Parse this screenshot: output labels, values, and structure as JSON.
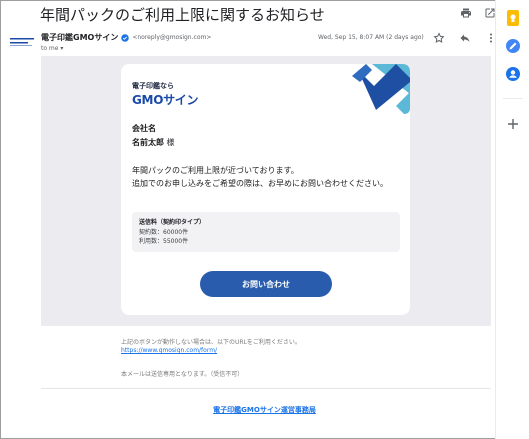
{
  "email": {
    "subject": "年間パックのご利用上限に関するお知らせ",
    "sender_name": "電子印鑑GMOサイン",
    "sender_email": "<noreply@gmosign.com>",
    "recipient_line": "to me ▾",
    "date": "Wed, Sep 15, 8:07 AM (2 days ago)"
  },
  "card": {
    "brand_sub": "電子印鑑なら",
    "brand_main": "GMOサイン",
    "company": "会社名",
    "person_name": "名前太郎",
    "honorific": " 様",
    "body_line1": "年間パックのご利用上限が近づいております。",
    "body_line2": "追加でのお申し込みをご希望の際は、お早めにお問い合わせください。",
    "info_title": "送信料（契約印タイプ）",
    "info_contract": "契約数：60000件",
    "info_usage": "利用数：55000件",
    "cta_label": "お問い合わせ"
  },
  "footer": {
    "note_button": "上記のボタンが動作しない場合は、以下のURLをご利用ください。",
    "url": "https://www.gmosign.com/form/",
    "note_sendonly": "本メールは送信専用となります。（受信不可）",
    "office_link": "電子印鑑GMOサイン運営事務局"
  },
  "icons": {
    "print": "print-icon",
    "open_new": "open-in-new-icon",
    "star": "star-icon",
    "reply": "reply-icon",
    "more": "more-vert-icon",
    "keep": "keep-icon",
    "tasks": "tasks-icon",
    "contacts": "contacts-icon",
    "add": "plus-icon"
  },
  "colors": {
    "brand_blue": "#2a5cad",
    "link_blue": "#1a73e8",
    "keep_yellow": "#fbbc04",
    "tasks_blue": "#4285f4",
    "contacts_blue": "#1a73e8"
  }
}
